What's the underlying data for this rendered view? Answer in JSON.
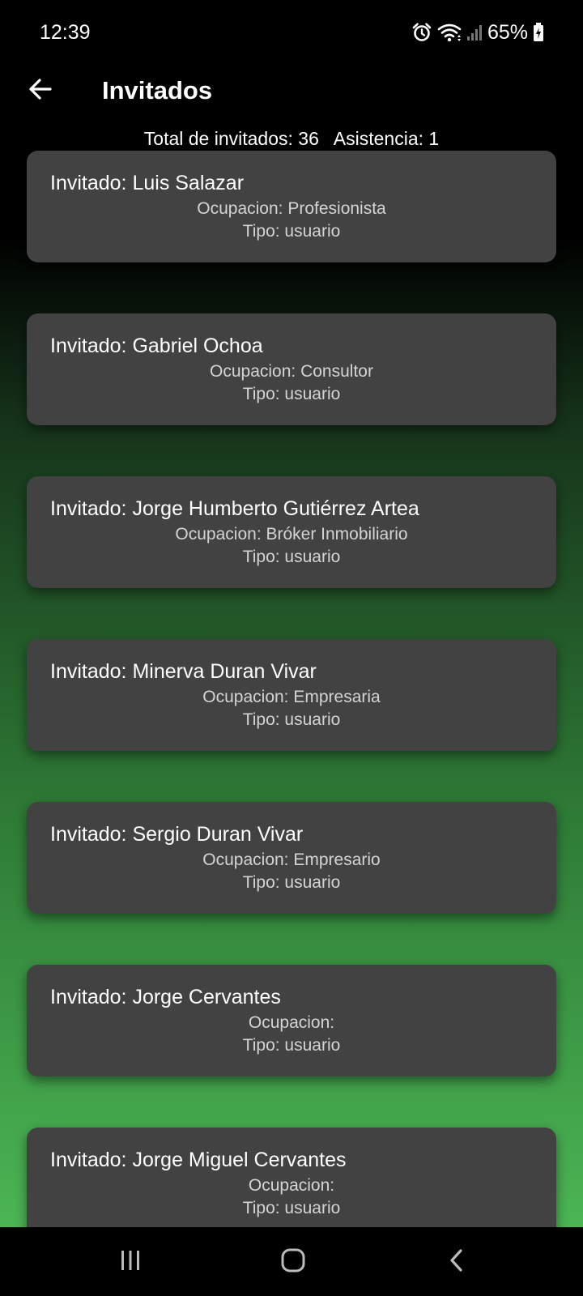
{
  "status_bar": {
    "time": "12:39",
    "battery": "65%",
    "icons": [
      "alarm-icon",
      "wifi-icon",
      "signal-icon",
      "battery-charging-icon"
    ]
  },
  "app_bar": {
    "title": "Invitados",
    "back_icon": "arrow-left-icon"
  },
  "summary": {
    "total": "Total de invitados: 36",
    "attendance": "Asistencia: 1"
  },
  "guests": [
    {
      "name": "Invitado: Luis Salazar",
      "occupation": "Ocupacion: Profesionista",
      "type": "Tipo: usuario"
    },
    {
      "name": "Invitado: Gabriel Ochoa",
      "occupation": "Ocupacion: Consultor",
      "type": "Tipo: usuario"
    },
    {
      "name": "Invitado: Jorge Humberto Gutiérrez Artea",
      "occupation": "Ocupacion: Bróker Inmobiliario",
      "type": "Tipo: usuario"
    },
    {
      "name": "Invitado: Minerva Duran Vivar",
      "occupation": "Ocupacion: Empresaria",
      "type": "Tipo: usuario"
    },
    {
      "name": "Invitado: Sergio Duran Vivar",
      "occupation": "Ocupacion: Empresario",
      "type": "Tipo: usuario"
    },
    {
      "name": "Invitado: Jorge Cervantes",
      "occupation": "Ocupacion:",
      "type": "Tipo: usuario"
    },
    {
      "name": "Invitado: Jorge Miguel Cervantes",
      "occupation": "Ocupacion:",
      "type": "Tipo: usuario"
    }
  ],
  "nav_bar": {
    "buttons": [
      "recent-apps-icon",
      "home-icon",
      "back-nav-icon"
    ]
  },
  "colors": {
    "card_background": "#424242",
    "gradient_bottom": "#4bb554"
  }
}
